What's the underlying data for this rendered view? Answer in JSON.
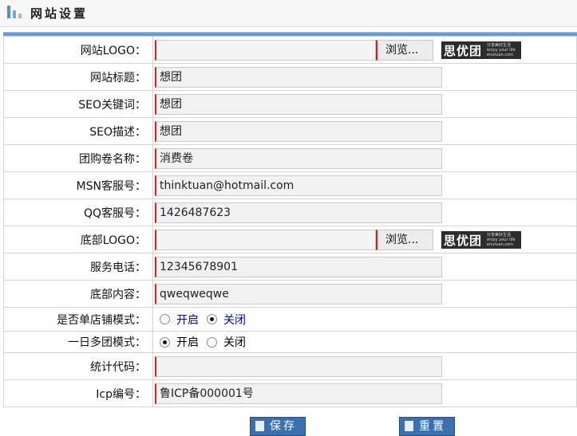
{
  "header": {
    "title": "网站设置"
  },
  "rows": [
    {
      "type": "file",
      "label": "网站LOGO：",
      "value": "",
      "browse": "浏览...",
      "logo": true
    },
    {
      "type": "text",
      "label": "网站标题：",
      "value": "想团"
    },
    {
      "type": "text",
      "label": "SEO关键词：",
      "value": "想团"
    },
    {
      "type": "text",
      "label": "SEO描述：",
      "value": "想团"
    },
    {
      "type": "text",
      "label": "团购卷名称：",
      "value": "消费卷"
    },
    {
      "type": "text",
      "label": "MSN客服号：",
      "value": "thinktuan@hotmail.com"
    },
    {
      "type": "text",
      "label": "QQ客服号：",
      "value": "1426487623"
    },
    {
      "type": "file",
      "label": "底部LOGO：",
      "value": "",
      "browse": "浏览...",
      "logo": true
    },
    {
      "type": "text",
      "label": "服务电话：",
      "value": "12345678901"
    },
    {
      "type": "text",
      "label": "底部内容：",
      "value": "qweqweqwe"
    },
    {
      "type": "radio",
      "label": "是否单店铺模式：",
      "options": [
        "开启",
        "关闭"
      ],
      "selected": 1,
      "link_style": true
    },
    {
      "type": "radio",
      "label": "一日多团模式：",
      "options": [
        "开启",
        "关闭"
      ],
      "selected": 0,
      "link_style": false
    },
    {
      "type": "text",
      "label": "统计代码：",
      "value": ""
    },
    {
      "type": "text",
      "label": "Icp编号：",
      "value": "鲁ICP备000001号"
    }
  ],
  "logo": {
    "main": "思优团",
    "sub_line1": "分享美好生活",
    "sub_line2": "enjoy your life",
    "sub_line3": "enutuan.com"
  },
  "buttons": {
    "save": "保存",
    "reset": "重置"
  },
  "colors": {
    "accent_bar": "#6b9bd1",
    "required_mark": "#d82020",
    "link": "#0000cc",
    "button": "#3a6fb0"
  }
}
